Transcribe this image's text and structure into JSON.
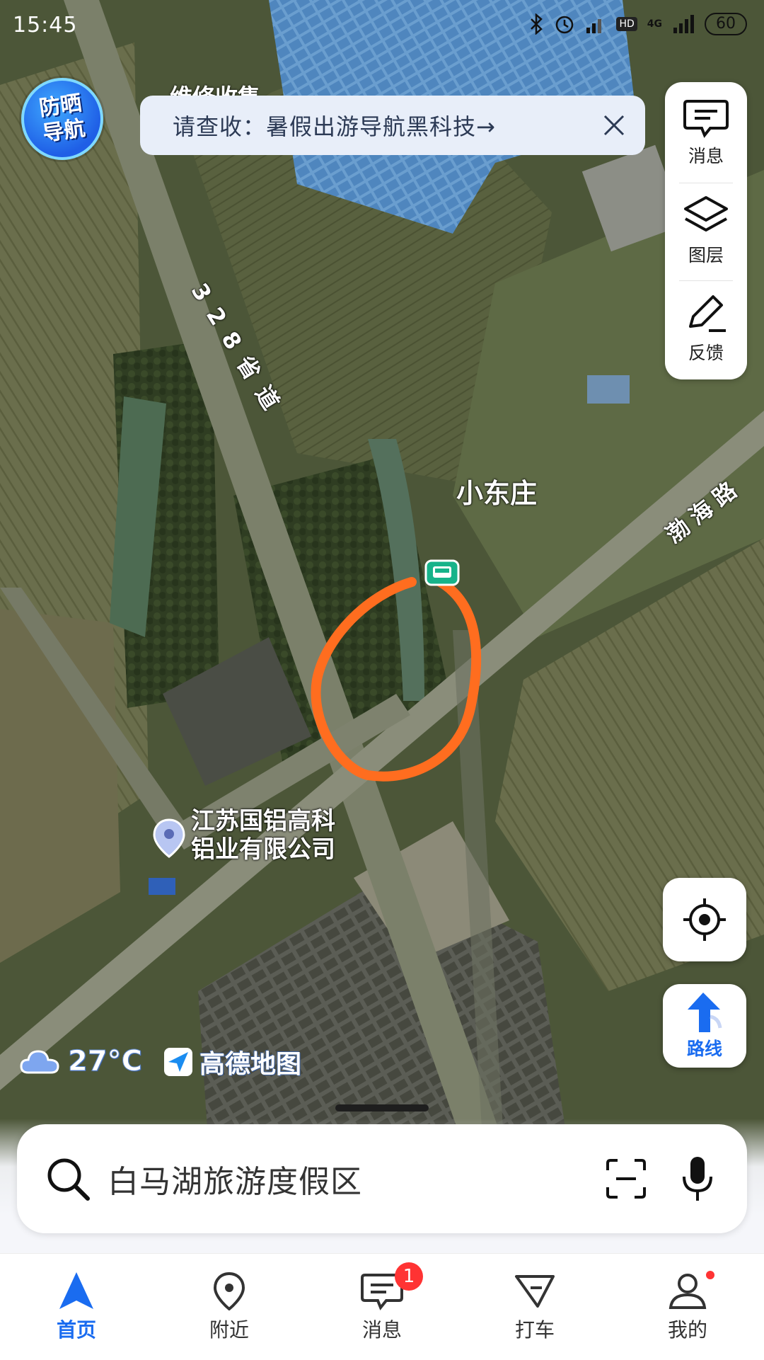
{
  "status_bar": {
    "time": "15:45",
    "network": "4G",
    "hd": "HD",
    "battery": "60"
  },
  "badge": {
    "text": "防晒导航"
  },
  "banner": {
    "behind_poi": "维修收售",
    "text": "请查收：暑假出游导航黑科技→"
  },
  "tools": [
    {
      "label": "消息",
      "icon": "message-icon"
    },
    {
      "label": "图层",
      "icon": "layers-icon"
    },
    {
      "label": "反馈",
      "icon": "feedback-pencil-icon"
    }
  ],
  "map": {
    "road_328": "328省道",
    "road_bohai": "渤海路",
    "place_xiaodong": "小东庄",
    "poi_company_line1": "江苏国铝高科",
    "poi_company_line2": "铝业有限公司",
    "annotation_color": "#ff6d1f"
  },
  "weather": {
    "temp": "27°C",
    "icon": "cloud-icon"
  },
  "brand": {
    "name": "高德地图"
  },
  "route_button": {
    "label": "路线"
  },
  "search": {
    "placeholder": "白马湖旅游度假区"
  },
  "tabs": [
    {
      "label": "首页",
      "active": true
    },
    {
      "label": "附近"
    },
    {
      "label": "消息",
      "badge": "1"
    },
    {
      "label": "打车"
    },
    {
      "label": "我的",
      "dot": true
    }
  ],
  "colors": {
    "accent": "#1a6cf0",
    "badge": "#ff3333"
  }
}
